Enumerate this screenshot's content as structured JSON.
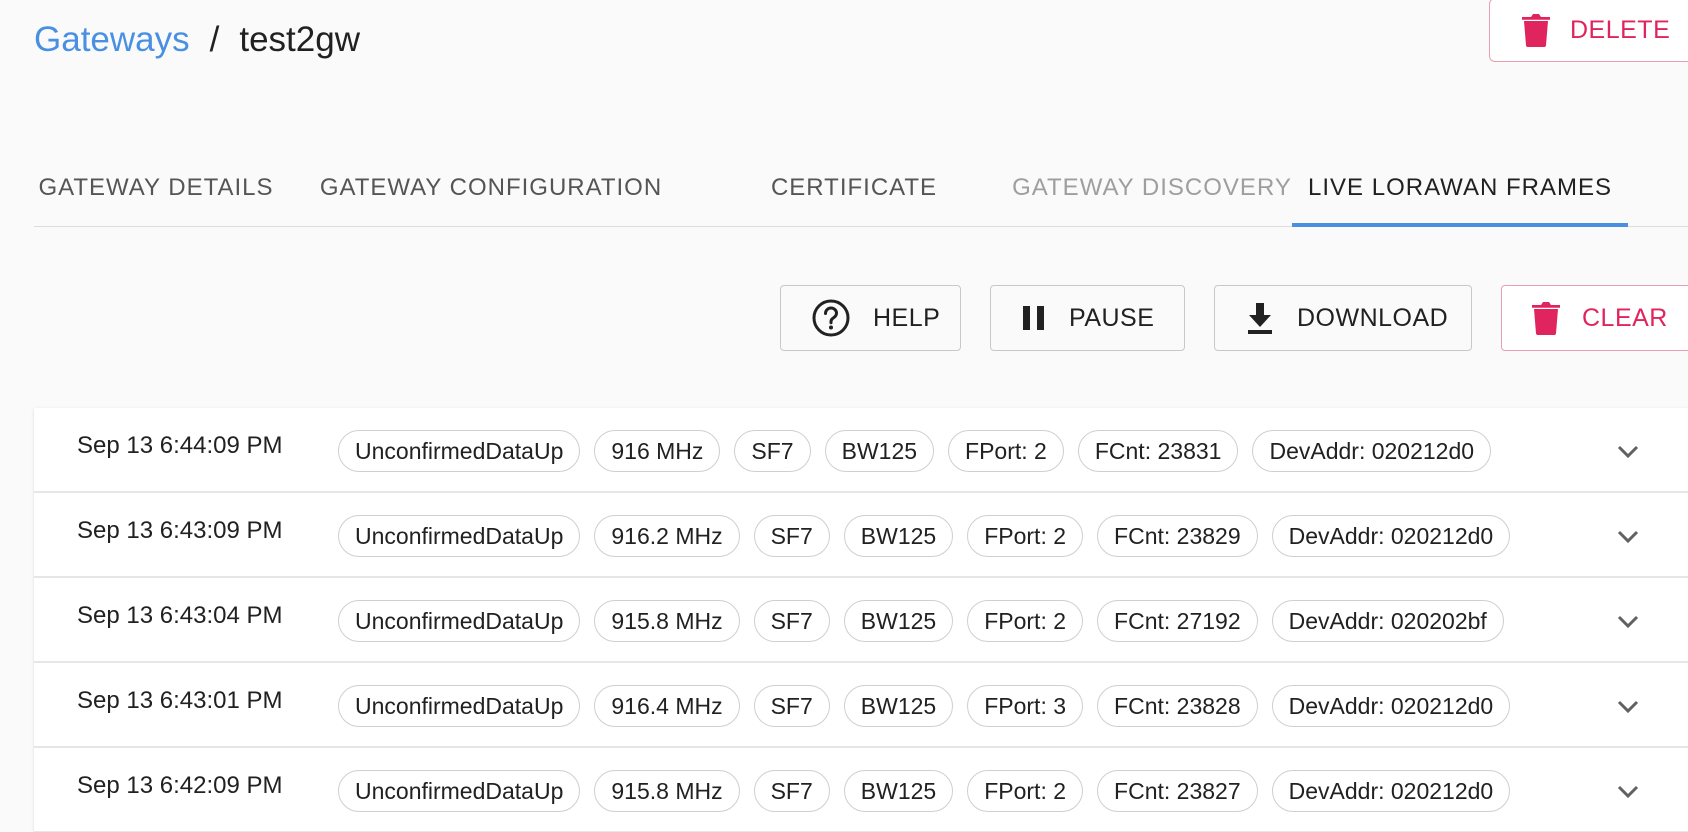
{
  "breadcrumb": {
    "parent": "Gateways",
    "separator": "/",
    "current": "test2gw"
  },
  "header": {
    "delete_label": "DELETE"
  },
  "tabs": [
    {
      "label": "GATEWAY DETAILS",
      "state": "normal"
    },
    {
      "label": "GATEWAY CONFIGURATION",
      "state": "normal"
    },
    {
      "label": "CERTIFICATE",
      "state": "normal"
    },
    {
      "label": "GATEWAY DISCOVERY",
      "state": "disabled"
    },
    {
      "label": "LIVE LORAWAN FRAMES",
      "state": "active"
    }
  ],
  "actions": {
    "help_label": "HELP",
    "pause_label": "PAUSE",
    "download_label": "DOWNLOAD",
    "clear_label": "CLEAR"
  },
  "icons": {
    "delete": "trash-icon",
    "help": "help-circle-icon",
    "pause": "pause-icon",
    "download": "download-icon",
    "clear": "trash-icon",
    "expand": "chevron-down-icon"
  },
  "colors": {
    "accent": "#4a90e2",
    "danger": "#e0245e"
  },
  "frames": [
    {
      "time": "Sep 13 6:44:09 PM",
      "type": "UnconfirmedDataUp",
      "freq": "916 MHz",
      "sf": "SF7",
      "bw": "BW125",
      "fport": "FPort: 2",
      "fcnt": "FCnt: 23831",
      "devaddr": "DevAddr: 020212d0"
    },
    {
      "time": "Sep 13 6:43:09 PM",
      "type": "UnconfirmedDataUp",
      "freq": "916.2 MHz",
      "sf": "SF7",
      "bw": "BW125",
      "fport": "FPort: 2",
      "fcnt": "FCnt: 23829",
      "devaddr": "DevAddr: 020212d0"
    },
    {
      "time": "Sep 13 6:43:04 PM",
      "type": "UnconfirmedDataUp",
      "freq": "915.8 MHz",
      "sf": "SF7",
      "bw": "BW125",
      "fport": "FPort: 2",
      "fcnt": "FCnt: 27192",
      "devaddr": "DevAddr: 020202bf"
    },
    {
      "time": "Sep 13 6:43:01 PM",
      "type": "UnconfirmedDataUp",
      "freq": "916.4 MHz",
      "sf": "SF7",
      "bw": "BW125",
      "fport": "FPort: 3",
      "fcnt": "FCnt: 23828",
      "devaddr": "DevAddr: 020212d0"
    },
    {
      "time": "Sep 13 6:42:09 PM",
      "type": "UnconfirmedDataUp",
      "freq": "915.8 MHz",
      "sf": "SF7",
      "bw": "BW125",
      "fport": "FPort: 2",
      "fcnt": "FCnt: 23827",
      "devaddr": "DevAddr: 020212d0"
    }
  ]
}
